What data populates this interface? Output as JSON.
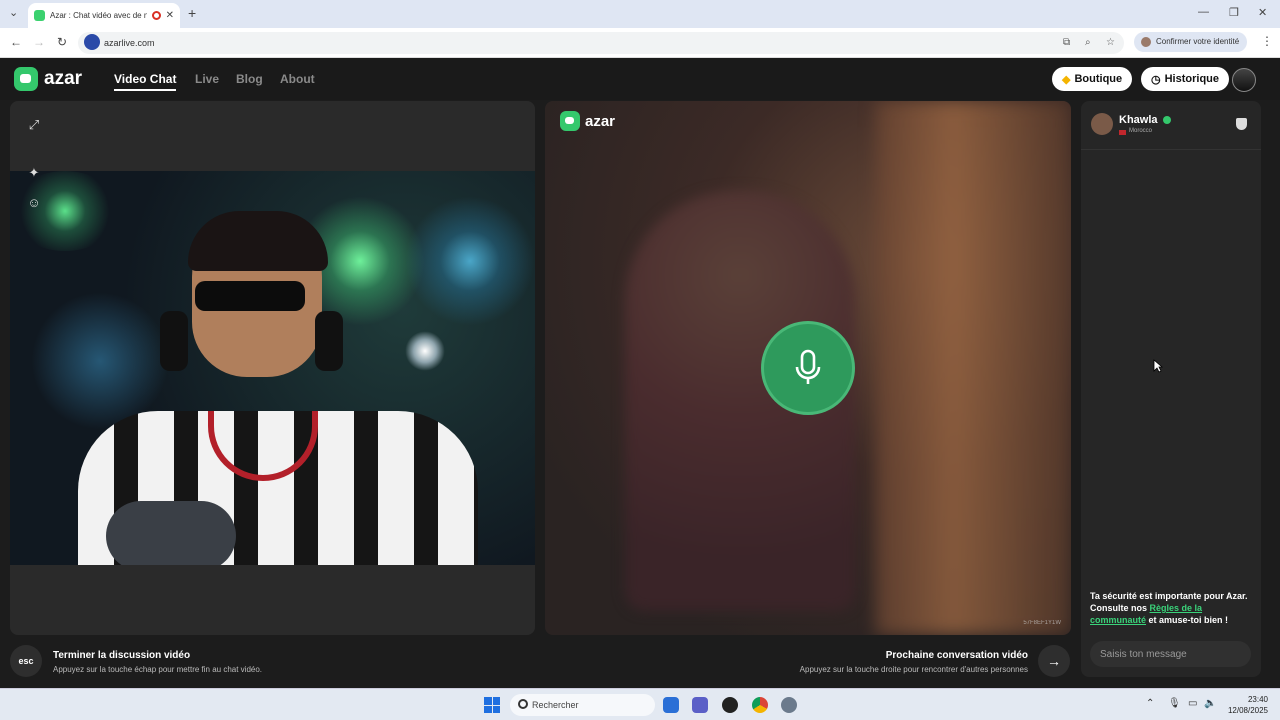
{
  "browser": {
    "tab_title": "Azar : Chat vidéo avec de n",
    "url": "azarlive.com",
    "confirm_identity": "Confirmer votre identité"
  },
  "header": {
    "logo_text": "azar",
    "nav": [
      "Video Chat",
      "Live",
      "Blog",
      "About"
    ],
    "boutique_label": "Boutique",
    "historique_label": "Historique"
  },
  "remote": {
    "logo_text": "azar",
    "user_id": "57F8EF1Y1W"
  },
  "side": {
    "peer_name": "Khawla",
    "peer_country": "Morocco",
    "safety_text": "Ta sécurité est importante pour Azar. Consulte nos ",
    "safety_link": "Règles de la communauté",
    "safety_end": " et amuse-toi bien !",
    "message_placeholder": "Saisis ton message"
  },
  "bottom": {
    "esc_key": "esc",
    "end_title": "Terminer la discussion vidéo",
    "end_sub": "Appuyez sur la touche échap pour mettre fin au chat vidéo.",
    "next_title": "Prochaine conversation vidéo",
    "next_sub": "Appuyez sur la touche droite pour rencontrer d'autres personnes"
  },
  "taskbar": {
    "search_label": "Rechercher",
    "time": "23:40",
    "date": "12/08/2025"
  },
  "colors": {
    "accent_green": "#34c86c",
    "mic_green": "#2e9a5c",
    "background": "#1c1c1c"
  }
}
